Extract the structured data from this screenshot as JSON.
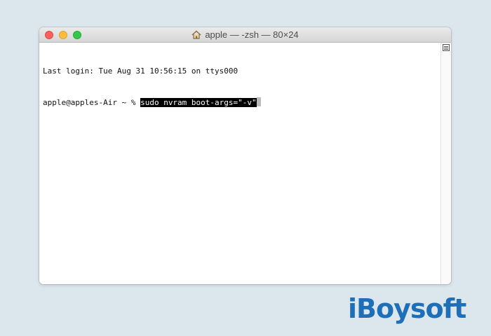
{
  "window": {
    "title": "apple — -zsh — 80×24"
  },
  "terminal": {
    "lines": [
      {
        "text": "Last login: Tue Aug 31 10:56:15 on ttys000"
      },
      {
        "prompt": "apple@apples-Air ~ % ",
        "command": "sudo nvram boot-args=\"-v\""
      }
    ]
  },
  "watermark": {
    "logo_text": "iBoysoft"
  },
  "colors": {
    "desktop": "#dce7ed",
    "close": "#fc605c",
    "minimize": "#fdbc40",
    "maximize": "#34c84a",
    "logo": "#1e6fb8"
  }
}
